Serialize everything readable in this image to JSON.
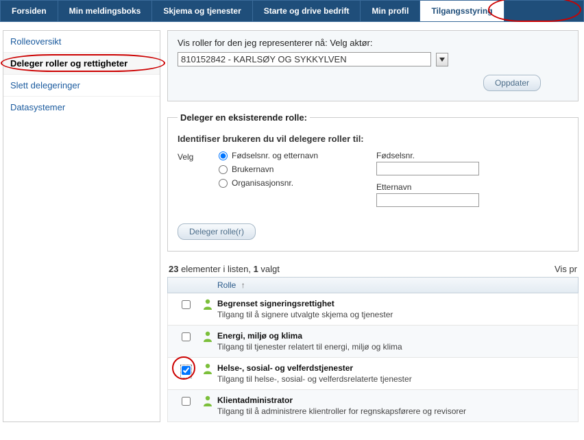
{
  "nav": {
    "items": [
      {
        "label": "Forsiden"
      },
      {
        "label": "Min meldingsboks"
      },
      {
        "label": "Skjema og tjenester"
      },
      {
        "label": "Starte og drive bedrift"
      },
      {
        "label": "Min profil"
      },
      {
        "label": "Tilgangsstyring"
      }
    ]
  },
  "sidebar": {
    "items": [
      {
        "label": "Rolleoversikt"
      },
      {
        "label": "Deleger roller og rettigheter"
      },
      {
        "label": "Slett delegeringer"
      },
      {
        "label": "Datasystemer"
      }
    ]
  },
  "actor": {
    "prompt": "Vis roller for den jeg representerer nå: Velg aktør:",
    "selected": "810152842 - KARLSØY OG SYKKYLVEN",
    "update_label": "Oppdater"
  },
  "delegate": {
    "legend": "Deleger en eksisterende rolle:",
    "identify_label": "Identifiser brukeren du vil delegere roller til:",
    "choose_label": "Velg",
    "radios": [
      {
        "label": "Fødselsnr. og etternavn",
        "checked": true
      },
      {
        "label": "Brukernavn",
        "checked": false
      },
      {
        "label": "Organisasjonsnr.",
        "checked": false
      }
    ],
    "field_fnr": "Fødselsnr.",
    "field_lastname": "Etternavn",
    "button_label": "Deleger rolle(r)"
  },
  "list": {
    "count_total": "23",
    "count_text_mid": " elementer i listen, ",
    "count_selected": "1",
    "count_text_end": " valgt",
    "vis_pr": "Vis pr",
    "col_role": "Rolle",
    "rows": [
      {
        "name": "Begrenset signeringsrettighet",
        "desc": "Tilgang til å signere utvalgte skjema og tjenester",
        "checked": false
      },
      {
        "name": "Energi, miljø og klima",
        "desc": "Tilgang til tjenester relatert til energi, miljø og klima",
        "checked": false
      },
      {
        "name": "Helse-, sosial- og velferdstjenester",
        "desc": "Tilgang til helse-, sosial- og velferdsrelaterte tjenester",
        "checked": true
      },
      {
        "name": "Klientadministrator",
        "desc": "Tilgang til å administrere klientroller for regnskapsførere og revisorer",
        "checked": false
      }
    ]
  }
}
